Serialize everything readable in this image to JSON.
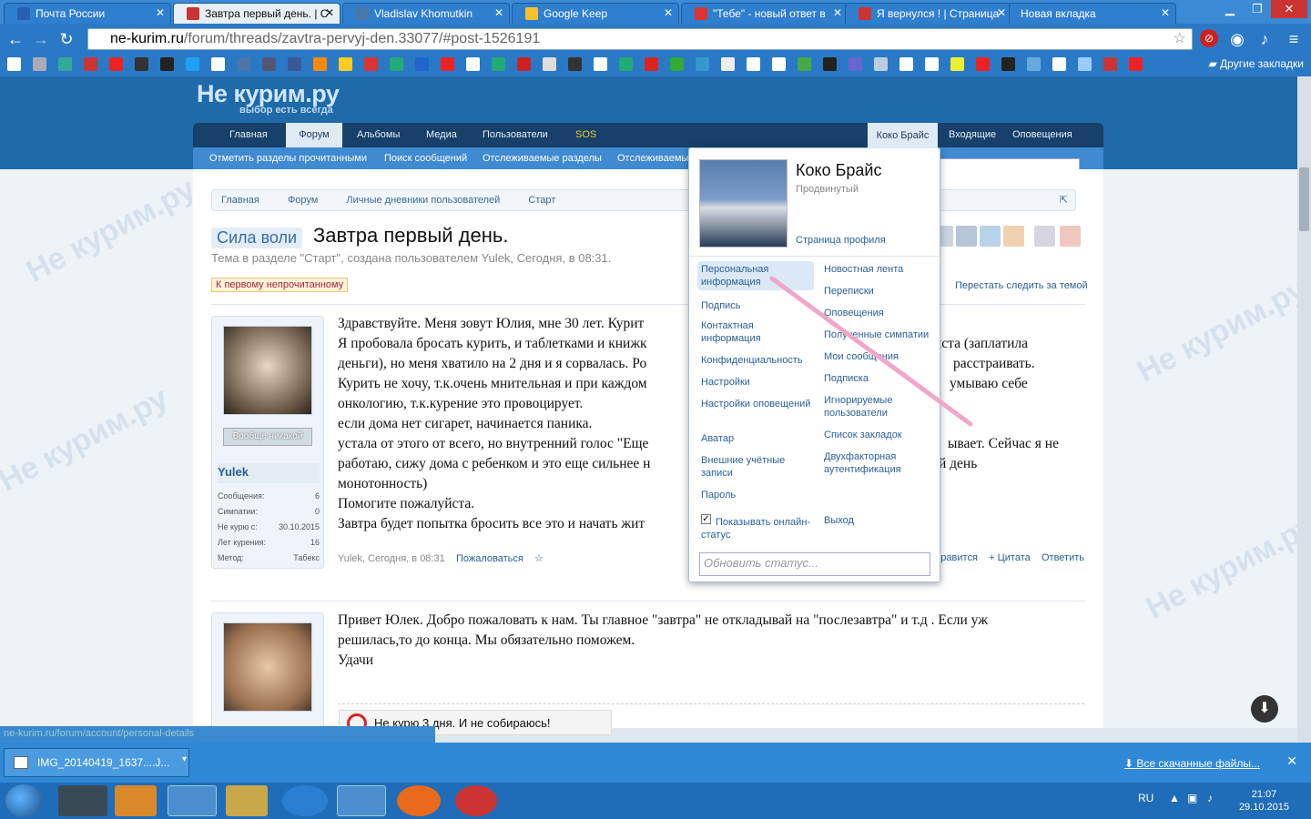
{
  "browser": {
    "tabs": [
      {
        "label": "Почта России",
        "active": false
      },
      {
        "label": "Завтра первый день. | С",
        "active": true
      },
      {
        "label": "Vladislav Khomutkin",
        "active": false
      },
      {
        "label": "Google Keep",
        "active": false
      },
      {
        "label": "\"Тебе\" - новый ответ в",
        "active": false
      },
      {
        "label": "Я вернулся ! | Страница",
        "active": false
      },
      {
        "label": "Новая вкладка",
        "active": false
      }
    ],
    "url_host": "ne-kurim.ru",
    "url_path": "/forum/threads/zavtra-pervyj-den.33077/#post-1526191",
    "other_bookmarks": "Другие закладки",
    "status_url": "ne-kurim.ru/forum/account/personal-details"
  },
  "site": {
    "logo": "Не курим.ру",
    "tagline": "выбор есть всегда",
    "watermark": "Не курим.ру",
    "nav": [
      "Главная",
      "Форум",
      "Альбомы",
      "Медиа",
      "Пользователи",
      "SOS"
    ],
    "nav_right": [
      "Коко Брайс",
      "Входящие",
      "Оповещения"
    ],
    "subnav": [
      "Отметить разделы прочитанными",
      "Поиск сообщений",
      "Отслеживаемые разделы",
      "Отслеживаемые"
    ]
  },
  "thread": {
    "breadcrumb": [
      "Главная",
      "Форум",
      "Личные дневники пользователей",
      "Старт"
    ],
    "prefix": "Сила воли",
    "title": "Завтра первый день.",
    "meta": "Тема в разделе \"Старт\", создана пользователем Yulek, Сегодня, в 08:31.",
    "first_unread": "К первому непрочитанному",
    "unwatch": "Перестать следить за темой"
  },
  "posts": [
    {
      "author": "Yulek",
      "badge": "Вообще никакой",
      "stats": [
        {
          "label": "Сообщения:",
          "value": "6"
        },
        {
          "label": "Симпатии:",
          "value": "0"
        },
        {
          "label": "Не курю с:",
          "value": "30.10.2015"
        },
        {
          "label": "Лет курения:",
          "value": "16"
        },
        {
          "label": "Метод:",
          "value": "Табекс"
        }
      ],
      "lines": [
        "Здравствуйте. Меня зовут Юлия, мне 30 лет. Курит",
        "Я пробовала бросать курить, и таблетками и книжк",
        "деньги), но меня хватило на 2 дня и я сорвалась. Ро",
        "Курить не хочу, т.к.очень мнительная и при каждом",
        "онкологию, т.к.курение это провоцирует.",
        "если дома нет сигарет, начинается паника.",
        "устала от этого от всего, но внутренний голос \"Еще",
        "работаю, сижу дома с ребенком и это еще сильнее н",
        "монотонность)",
        "Помогите пожалуйста.",
        "Завтра будет попытка бросить все это и начать жит"
      ],
      "lines_right": [
        "иста (заплатила",
        "расстраивать.",
        "умываю себе",
        "ывает. Сейчас я не",
        "й день"
      ],
      "foot_author": "Yulek, Сегодня, в 08:31",
      "foot_report": "Пожаловаться",
      "foot_links": [
        "нравится",
        "+ Цитата",
        "Ответить"
      ]
    },
    {
      "lines": [
        "Привет Юлек. Добро пожаловать к нам. Ты главное \"завтра\" не откладывай на \"послезавтра\" и т.д . Если уж",
        "решилась,то до конца. Мы обязательно поможем.",
        "Удачи"
      ],
      "signature": "Не курю 3 дня. И не собираюсь!"
    }
  ],
  "account_popup": {
    "name": "Коко Брайс",
    "rank": "Продвинутый",
    "profile_link": "Страница профиля",
    "left_links": [
      "Персональная информация",
      "Подпись",
      "Контактная информация",
      "Конфиденциальность",
      "Настройки",
      "Настройки оповещений",
      "Аватар",
      "Внешние учётные записи",
      "Пароль"
    ],
    "right_links": [
      "Новостная лента",
      "Переписки",
      "Оповещения",
      "Полученные симпатии",
      "Мои сообщения",
      "Подписка",
      "Игнорируемые пользователи",
      "Список закладок",
      "Двухфакторная аутентификация"
    ],
    "show_online": "Показывать онлайн-статус",
    "logout": "Выход",
    "status_placeholder": "Обновить статус..."
  },
  "downloads": {
    "file": "IMG_20140419_1637....J...",
    "all": "Все скачанные файлы..."
  },
  "taskbar": {
    "lang": "RU",
    "time": "21:07",
    "date": "29.10.2015"
  },
  "colors": {
    "accent": "#2a79c6",
    "link": "#2a5f9a",
    "nav_dark": "#17406a",
    "arrow": "#f0a6c8"
  }
}
